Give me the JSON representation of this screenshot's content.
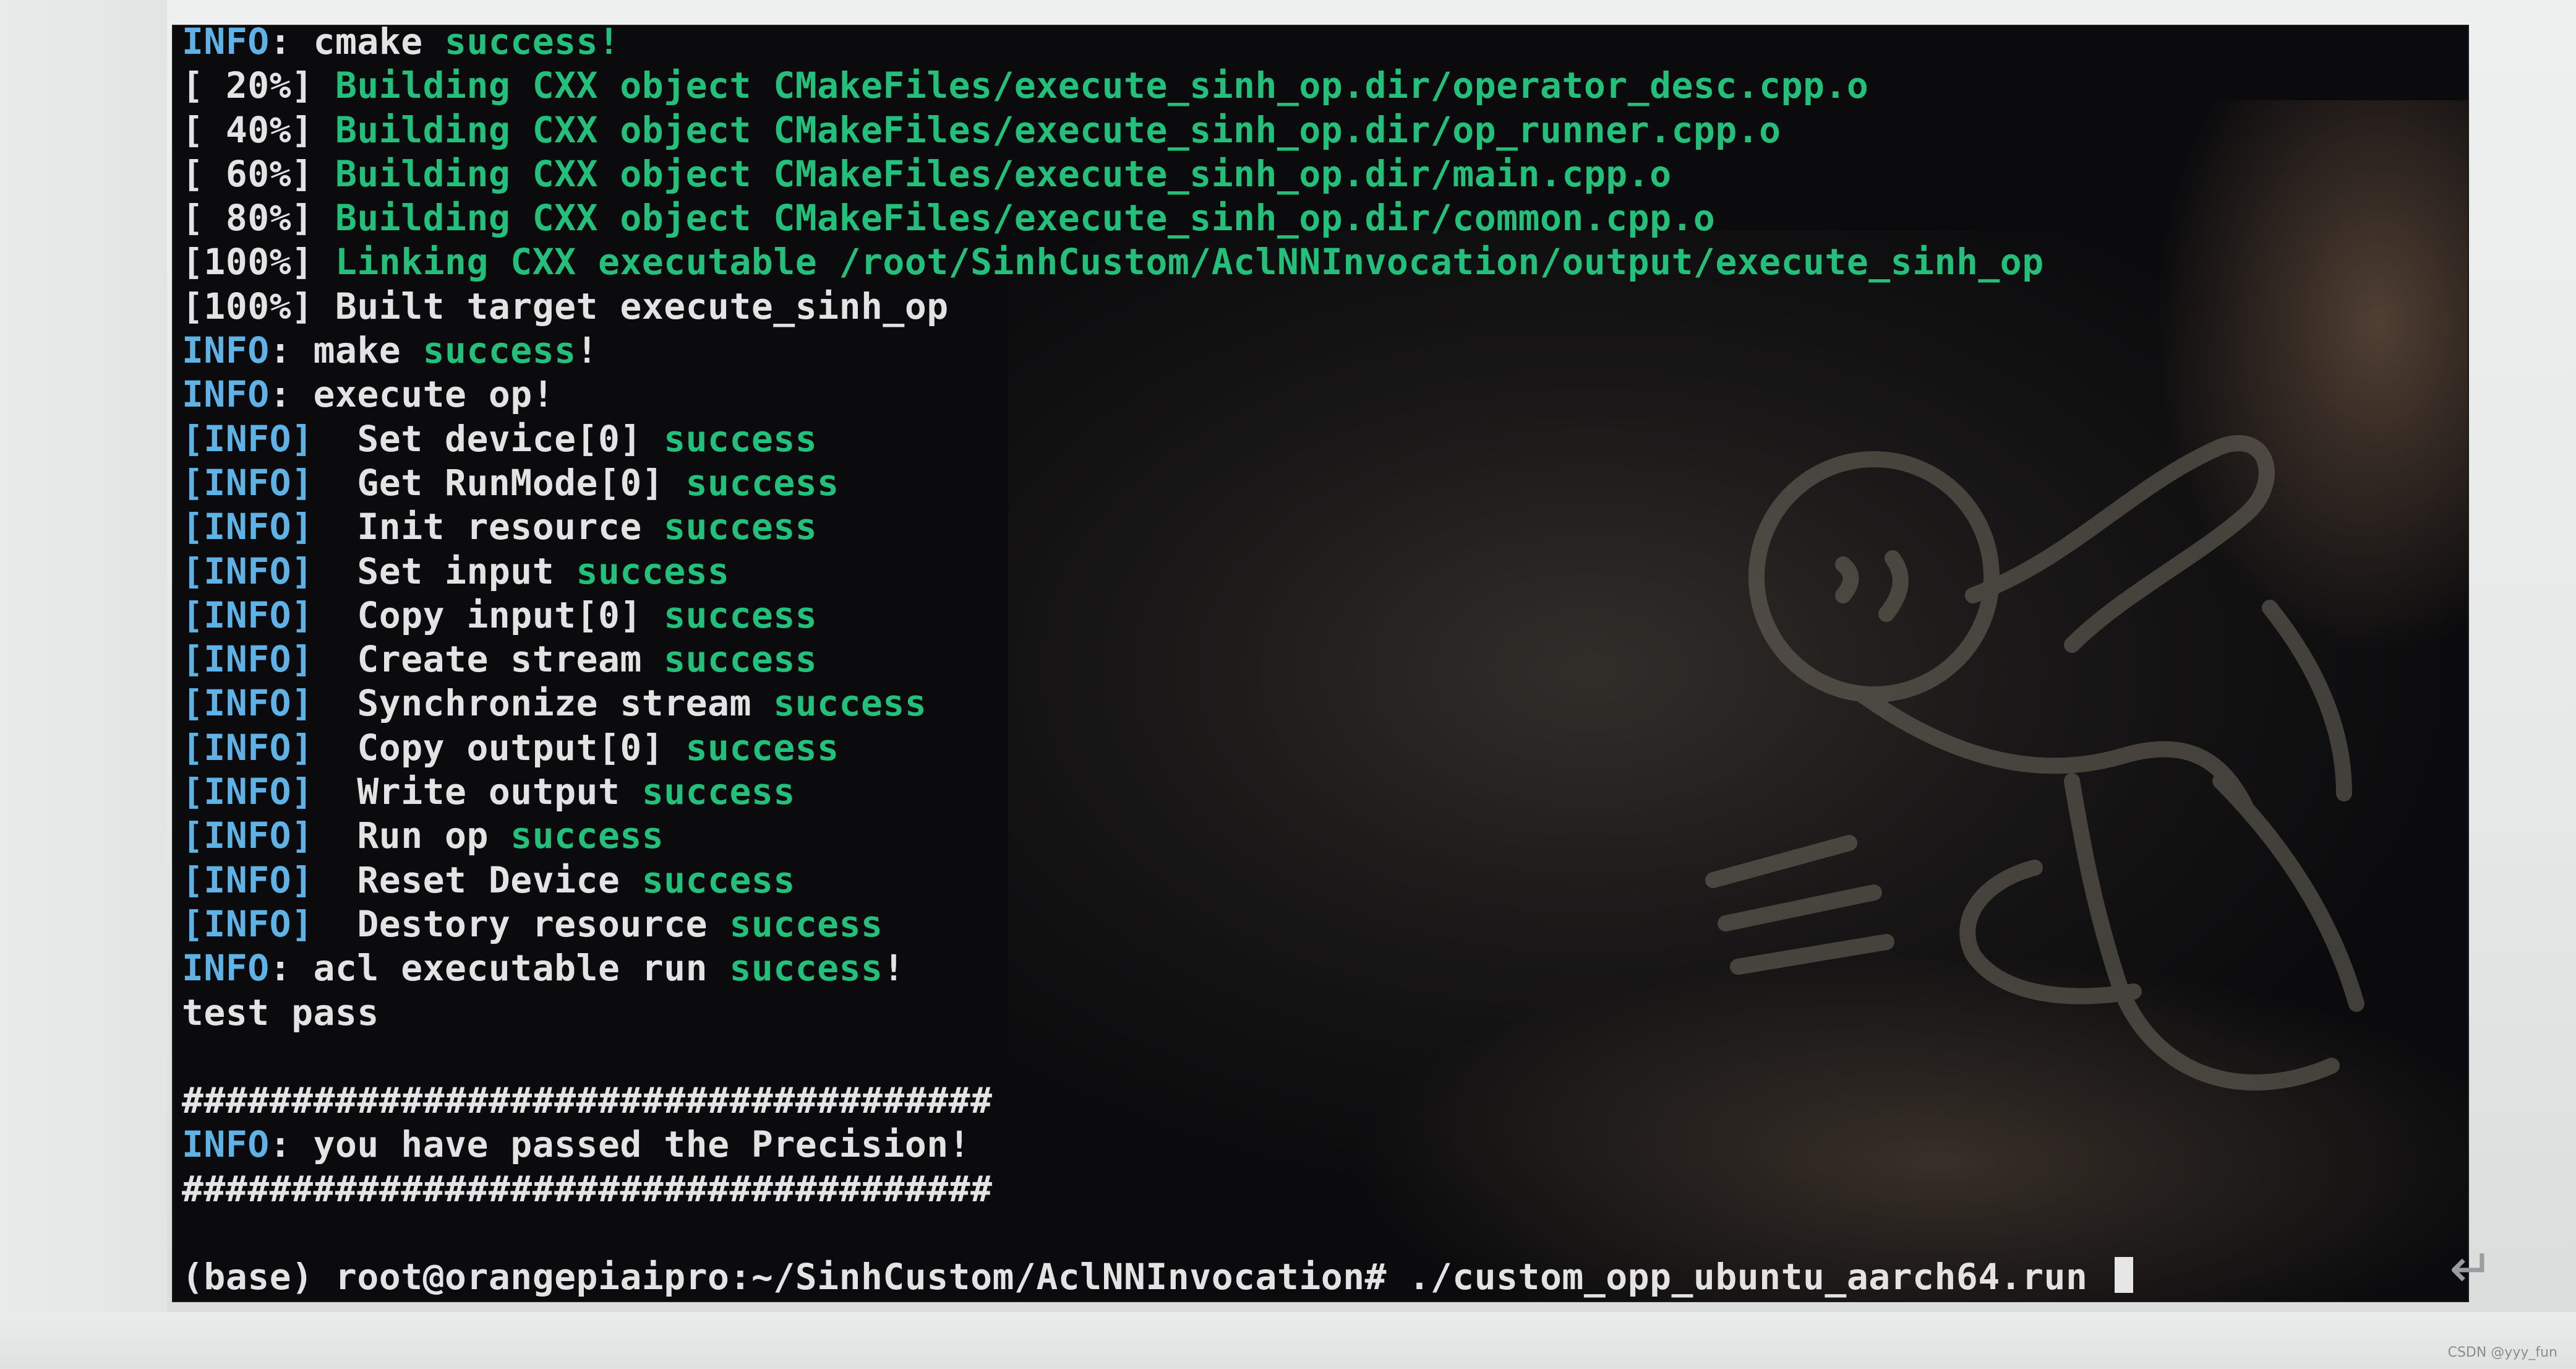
{
  "terminal": {
    "lines": [
      {
        "segments": [
          {
            "text": "INFO",
            "color": "c"
          },
          {
            "text": ": cmake ",
            "color": "w"
          },
          {
            "text": "success!",
            "color": "g"
          }
        ]
      },
      {
        "segments": [
          {
            "text": "[ 20%] ",
            "color": "w"
          },
          {
            "text": "Building CXX object CMakeFiles/execute_sinh_op.dir/operator_desc.cpp.o",
            "color": "g"
          }
        ]
      },
      {
        "segments": [
          {
            "text": "[ 40%] ",
            "color": "w"
          },
          {
            "text": "Building CXX object CMakeFiles/execute_sinh_op.dir/op_runner.cpp.o",
            "color": "g"
          }
        ]
      },
      {
        "segments": [
          {
            "text": "[ 60%] ",
            "color": "w"
          },
          {
            "text": "Building CXX object CMakeFiles/execute_sinh_op.dir/main.cpp.o",
            "color": "g"
          }
        ]
      },
      {
        "segments": [
          {
            "text": "[ 80%] ",
            "color": "w"
          },
          {
            "text": "Building CXX object CMakeFiles/execute_sinh_op.dir/common.cpp.o",
            "color": "g"
          }
        ]
      },
      {
        "segments": [
          {
            "text": "[100%] ",
            "color": "w"
          },
          {
            "text": "Linking CXX executable /root/SinhCustom/AclNNInvocation/output/execute_sinh_op",
            "color": "g"
          }
        ]
      },
      {
        "segments": [
          {
            "text": "[100%] Built target execute_sinh_op",
            "color": "w"
          }
        ]
      },
      {
        "segments": [
          {
            "text": "INFO",
            "color": "c"
          },
          {
            "text": ": make ",
            "color": "w"
          },
          {
            "text": "success",
            "color": "g"
          },
          {
            "text": "!",
            "color": "w"
          }
        ]
      },
      {
        "segments": [
          {
            "text": "INFO",
            "color": "c"
          },
          {
            "text": ": execute op!",
            "color": "w"
          }
        ]
      },
      {
        "segments": [
          {
            "text": "[INFO]",
            "color": "c"
          },
          {
            "text": "  Set device[0] ",
            "color": "w"
          },
          {
            "text": "success",
            "color": "g"
          }
        ]
      },
      {
        "segments": [
          {
            "text": "[INFO]",
            "color": "c"
          },
          {
            "text": "  Get RunMode[0] ",
            "color": "w"
          },
          {
            "text": "success",
            "color": "g"
          }
        ]
      },
      {
        "segments": [
          {
            "text": "[INFO]",
            "color": "c"
          },
          {
            "text": "  Init resource ",
            "color": "w"
          },
          {
            "text": "success",
            "color": "g"
          }
        ]
      },
      {
        "segments": [
          {
            "text": "[INFO]",
            "color": "c"
          },
          {
            "text": "  Set input ",
            "color": "w"
          },
          {
            "text": "success",
            "color": "g"
          }
        ]
      },
      {
        "segments": [
          {
            "text": "[INFO]",
            "color": "c"
          },
          {
            "text": "  Copy input[0] ",
            "color": "w"
          },
          {
            "text": "success",
            "color": "g"
          }
        ]
      },
      {
        "segments": [
          {
            "text": "[INFO]",
            "color": "c"
          },
          {
            "text": "  Create stream ",
            "color": "w"
          },
          {
            "text": "success",
            "color": "g"
          }
        ]
      },
      {
        "segments": [
          {
            "text": "[INFO]",
            "color": "c"
          },
          {
            "text": "  Synchronize stream ",
            "color": "w"
          },
          {
            "text": "success",
            "color": "g"
          }
        ]
      },
      {
        "segments": [
          {
            "text": "[INFO]",
            "color": "c"
          },
          {
            "text": "  Copy output[0] ",
            "color": "w"
          },
          {
            "text": "success",
            "color": "g"
          }
        ]
      },
      {
        "segments": [
          {
            "text": "[INFO]",
            "color": "c"
          },
          {
            "text": "  Write output ",
            "color": "w"
          },
          {
            "text": "success",
            "color": "g"
          }
        ]
      },
      {
        "segments": [
          {
            "text": "[INFO]",
            "color": "c"
          },
          {
            "text": "  Run op ",
            "color": "w"
          },
          {
            "text": "success",
            "color": "g"
          }
        ]
      },
      {
        "segments": [
          {
            "text": "[INFO]",
            "color": "c"
          },
          {
            "text": "  Reset Device ",
            "color": "w"
          },
          {
            "text": "success",
            "color": "g"
          }
        ]
      },
      {
        "segments": [
          {
            "text": "[INFO]",
            "color": "c"
          },
          {
            "text": "  Destory resource ",
            "color": "w"
          },
          {
            "text": "success",
            "color": "g"
          }
        ]
      },
      {
        "segments": [
          {
            "text": "INFO",
            "color": "c"
          },
          {
            "text": ": acl executable run ",
            "color": "w"
          },
          {
            "text": "success",
            "color": "g"
          },
          {
            "text": "!",
            "color": "w"
          }
        ]
      },
      {
        "segments": [
          {
            "text": "test pass",
            "color": "w"
          }
        ]
      },
      {
        "segments": []
      },
      {
        "segments": [
          {
            "text": "#####################################",
            "color": "w"
          }
        ]
      },
      {
        "segments": [
          {
            "text": "INFO",
            "color": "c"
          },
          {
            "text": ": you have passed the Precision!",
            "color": "w"
          }
        ]
      },
      {
        "segments": [
          {
            "text": "#####################################",
            "color": "w"
          }
        ]
      },
      {
        "segments": []
      },
      {
        "segments": [
          {
            "text": "(base) root@orangepiaipro:~/SinhCustom/AclNNInvocation# ./custom_opp_ubuntu_aarch64.run ",
            "color": "w"
          }
        ],
        "cursor": true
      }
    ]
  },
  "colors": {
    "success_green": "#22c07a",
    "info_cyan": "#5fb2e6",
    "text_white": "#e3e3e3",
    "terminal_bg": "#0b0b0d"
  },
  "icons": {
    "return_arrow": "return-arrow-icon"
  },
  "page": {
    "return_glyph": "↵",
    "watermark": "CSDN @yyy_fun"
  }
}
